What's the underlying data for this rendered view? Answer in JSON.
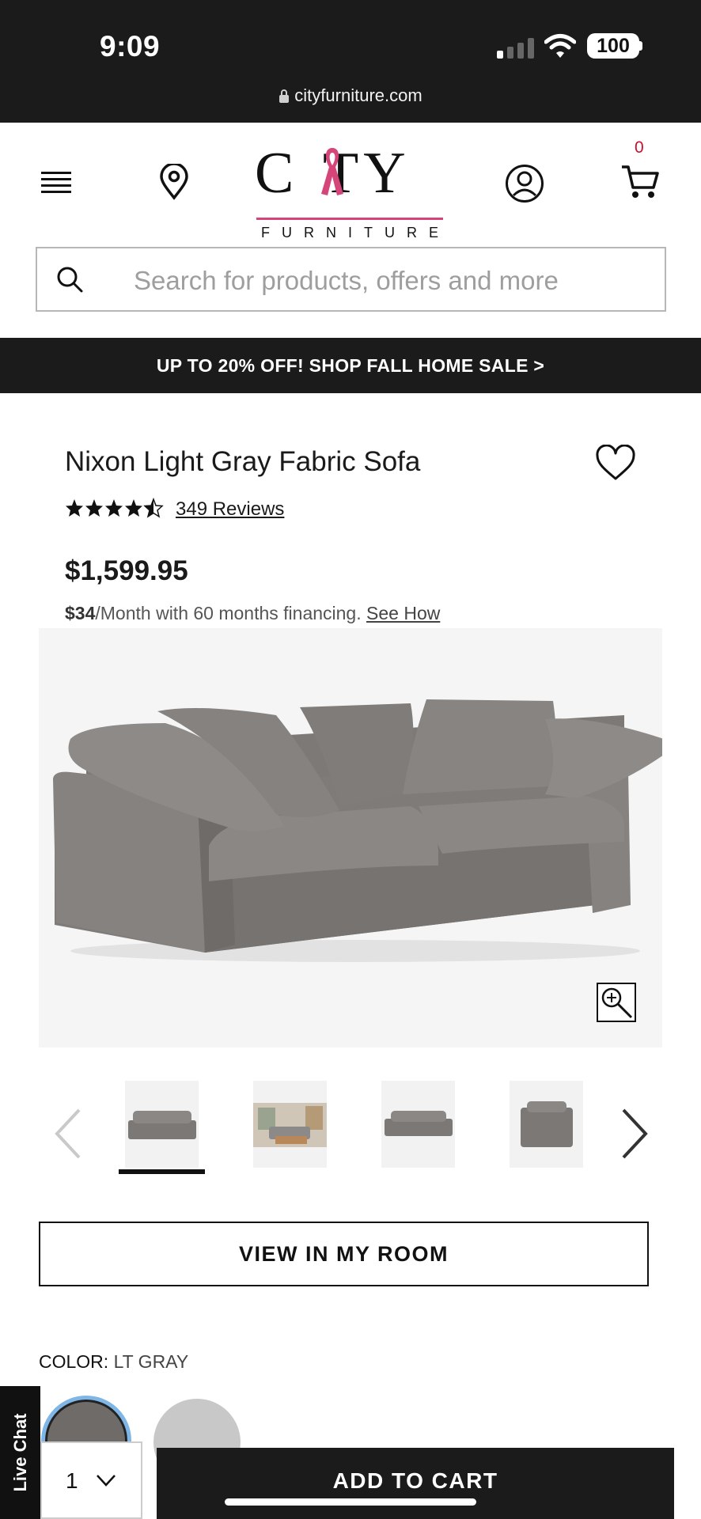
{
  "status_bar": {
    "time": "9:09",
    "battery": "100"
  },
  "browser": {
    "url": "cityfurniture.com"
  },
  "header": {
    "logo_main": "CITY",
    "logo_sub": "FURNITURE",
    "cart_count": "0",
    "icons": [
      "menu-icon",
      "location-pin-icon",
      "account-icon",
      "cart-icon"
    ]
  },
  "search": {
    "placeholder": "Search for products, offers and more"
  },
  "promo": {
    "text": "UP TO 20% OFF! SHOP FALL HOME SALE >"
  },
  "product": {
    "title": "Nixon Light Gray Fabric Sofa",
    "rating": 4.5,
    "reviews": "349 Reviews",
    "price": "$1,599.95",
    "financing_amount": "$34",
    "financing_text": "/Month with 60 months financing.",
    "financing_link": "See How",
    "thumbnail_count": 4,
    "active_thumbnail": 0
  },
  "actions": {
    "view_in_room": "VIEW IN MY ROOM",
    "add_to_cart": "ADD TO CART",
    "quantity": "1"
  },
  "color": {
    "label": "COLOR:",
    "value": "LT GRAY",
    "swatches": [
      "#6e6b69",
      "#c8c8c8"
    ]
  },
  "live_chat": "Live Chat",
  "colors": {
    "dark": "#1b1b1b",
    "brand_pink": "#d6457a",
    "cart_badge": "#c8102e"
  }
}
